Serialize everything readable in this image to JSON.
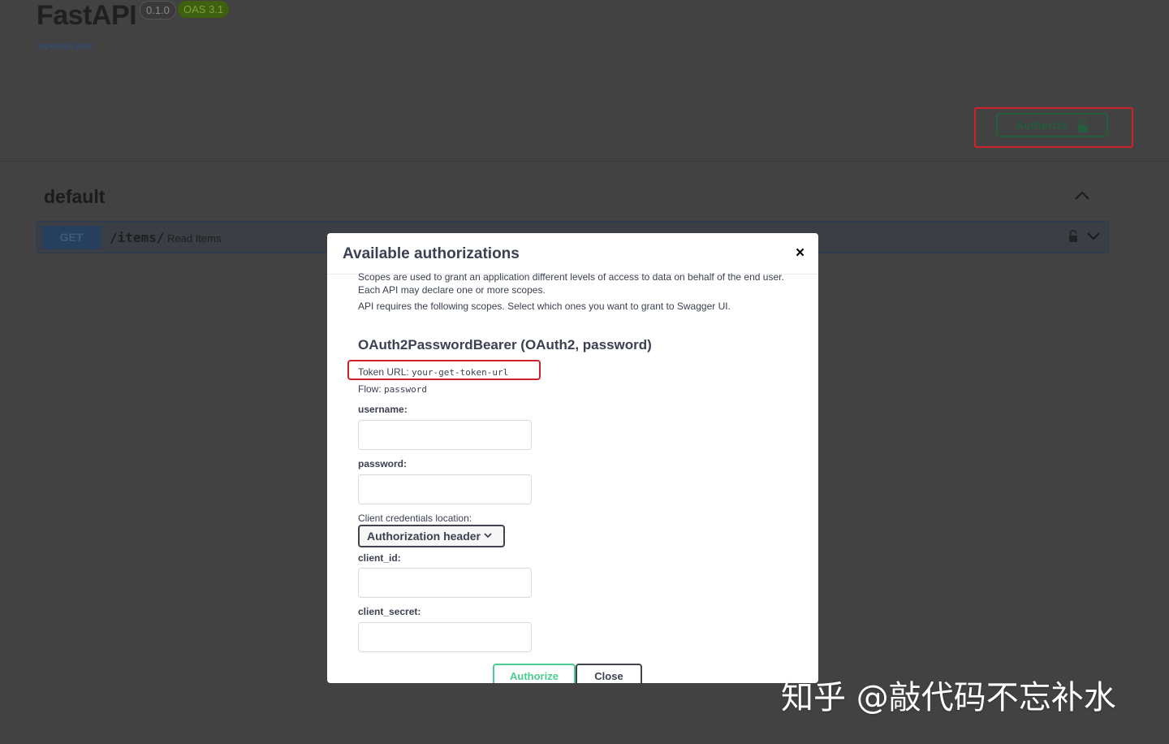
{
  "app": {
    "title": "FastAPI",
    "version_badge": "0.1.0",
    "oas_badge": "OAS 3.1",
    "openapi_link": "/openapi.json",
    "authorize_label": "Authorize"
  },
  "section": {
    "title": "default",
    "operation": {
      "method": "GET",
      "path": "/items/",
      "summary": "Read Items"
    }
  },
  "modal": {
    "title": "Available authorizations",
    "close_glyph": "×",
    "scope_intro_1": "Scopes are used to grant an application different levels of access to data on behalf of the end user.",
    "scope_intro_2": "Each API may declare one or more scopes.",
    "scope_intro_3": "API requires the following scopes. Select which ones you want to grant to Swagger UI.",
    "scheme_title": "OAuth2PasswordBearer (OAuth2, password)",
    "token_url_label": "Token URL:",
    "token_url_value": "your-get-token-url",
    "flow_label": "Flow:",
    "flow_value": "password",
    "fields": {
      "username_label": "username:",
      "username_value": "",
      "password_label": "password:",
      "password_value": "",
      "credentials_location_label": "Client credentials location:",
      "credentials_location_value": "Authorization header",
      "client_id_label": "client_id:",
      "client_id_value": "",
      "client_secret_label": "client_secret:",
      "client_secret_value": ""
    },
    "authorize_button": "Authorize",
    "close_button": "Close"
  },
  "watermark": "知乎 @敲代码不忘补水",
  "colors": {
    "overlay_bg": "#424242",
    "modal_bg": "#ffffff",
    "get_method": "#61affe",
    "authorize_green": "#49cc90",
    "highlight_red": "#d0212a"
  }
}
